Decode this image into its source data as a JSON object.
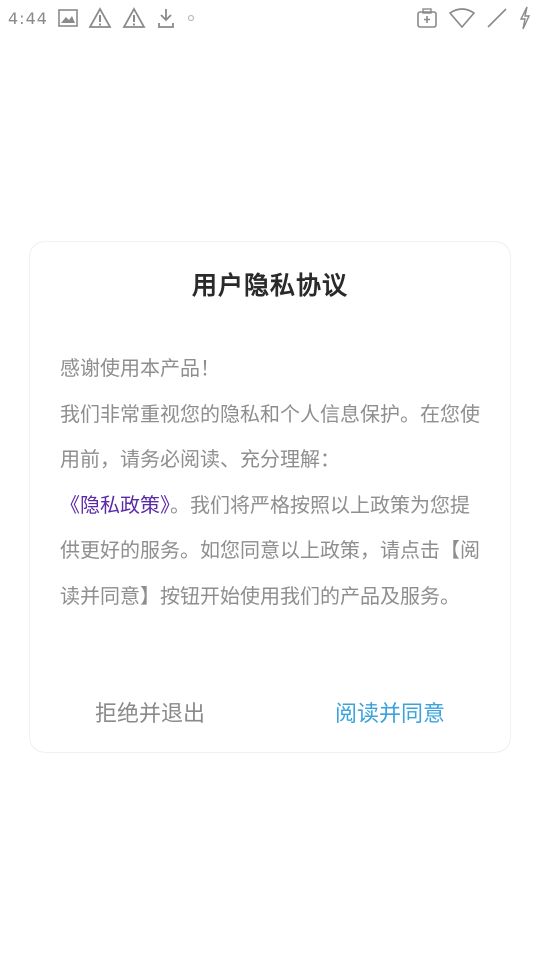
{
  "status_bar": {
    "time": "4:44",
    "left_icons": [
      "image-icon",
      "warning-icon",
      "warning-icon",
      "download-icon",
      "dot-icon"
    ],
    "right_icons": [
      "sim-card-icon",
      "wifi-icon",
      "signal-icon",
      "battery-charging-icon"
    ]
  },
  "dialog": {
    "title": "用户隐私协议",
    "body_intro": "感谢使用本产品！\n我们非常重视您的隐私和个人信息保护。在您使用前，请务必阅读、充分理解：",
    "policy_link": "《隐私政策》",
    "body_rest": "。我们将严格按照以上政策为您提供更好的服务。如您同意以上政策，请点击【阅读并同意】按钮开始使用我们的产品及服务。",
    "reject_label": "拒绝并退出",
    "accept_label": "阅读并同意"
  },
  "colors": {
    "link": "#5b2aa8",
    "accept": "#3aa3dc",
    "text": "#8e8e8e"
  }
}
